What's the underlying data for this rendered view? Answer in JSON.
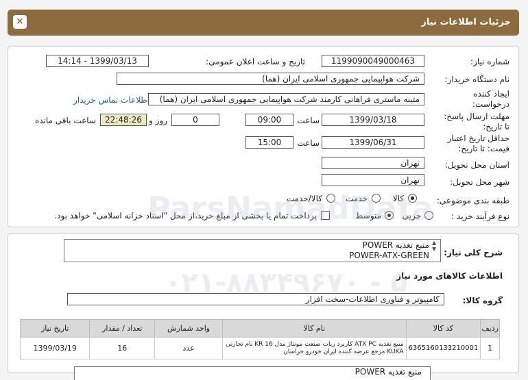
{
  "header": {
    "title": "جزئیات اطلاعات نیاز",
    "close": "×"
  },
  "form": {
    "need_number_label": "شماره نیاز:",
    "need_number": "1199090049000463",
    "announce_label": "تاریخ و ساعت اعلان عمومی:",
    "announce_value": "1399/03/13 - 14:14",
    "buyer_org_label": "نام دستگاه خریدار:",
    "buyer_org": "شرکت هواپیمایی جمهوری اسلامی ایران (هما)",
    "creator_label_1": "ایجاد کننده",
    "creator_label_2": "درخواست:",
    "creator": "متینه ماستری فراهانی کارمند شرکت هواپیمایی جمهوری اسلامی ایران (هما)",
    "contact_link": "اطلاعات تماس خریدار",
    "deadline_label_1": "مهلت ارسال پاسخ:",
    "deadline_label_2": "تا تاریخ:",
    "deadline_date": "1399/03/18",
    "time_label": "ساعت",
    "deadline_time": "09:00",
    "days_value": "0",
    "days_label": "روز و",
    "remaining_time": "22:48:26",
    "remaining_label": "ساعت باقی مانده",
    "validity_label_1": "حداقل تاریخ اعتبار",
    "validity_label_2": "قیمت: تا تاریخ:",
    "validity_date": "1399/06/31",
    "validity_time": "15:00",
    "province_label": "استان محل تحویل:",
    "province": "تهران",
    "city_label": "شهر محل تحویل:",
    "city": "تهران",
    "category_label": "طبقه بندی موضوعی:",
    "category_options": [
      "کالا",
      "خدمت",
      "کالا/خدمت"
    ],
    "process_label": "نوع فرآیند خرید :",
    "process_options": [
      "جزیی",
      "متوسط"
    ],
    "payment_text": "پرداخت تمام یا بخشی از مبلغ خرید،از محل \"اسناد خزانه اسلامی\" خواهد بود."
  },
  "description": {
    "label": "شرح کلی نیاز:",
    "line1": "منبع تغذیه POWER",
    "line2": "POWER-ATX-GREEN"
  },
  "goods_info_title": "اطلاعات کالاهای مورد نیاز",
  "goods_group_label": "گروه کالا:",
  "goods_group": "کامپیوتر و فناوری اطلاعات-سخت افزار",
  "table": {
    "headers": [
      "ردیف",
      "کد کالا",
      "نام کالا",
      "واحد شمارش",
      "تعداد / مقدار",
      "تاریخ نیاز"
    ],
    "rows": [
      [
        "1",
        "6365160133210001",
        "منبع تغذیه ATX PC کاربرد ربات صنعت مونتاژ مدل KR 16 نام تجارتی KUKA مرجع عرضه کننده ایران خودرو خراسان",
        "عدد",
        "16",
        "1399/03/19"
      ]
    ]
  },
  "bottom_snippet": "منبع تغذیه POWER",
  "watermark": {
    "line1": "ParsNamadData",
    "line2": "۰۲۱-۸۸۳۴۹۶۷۰ - ۵"
  }
}
